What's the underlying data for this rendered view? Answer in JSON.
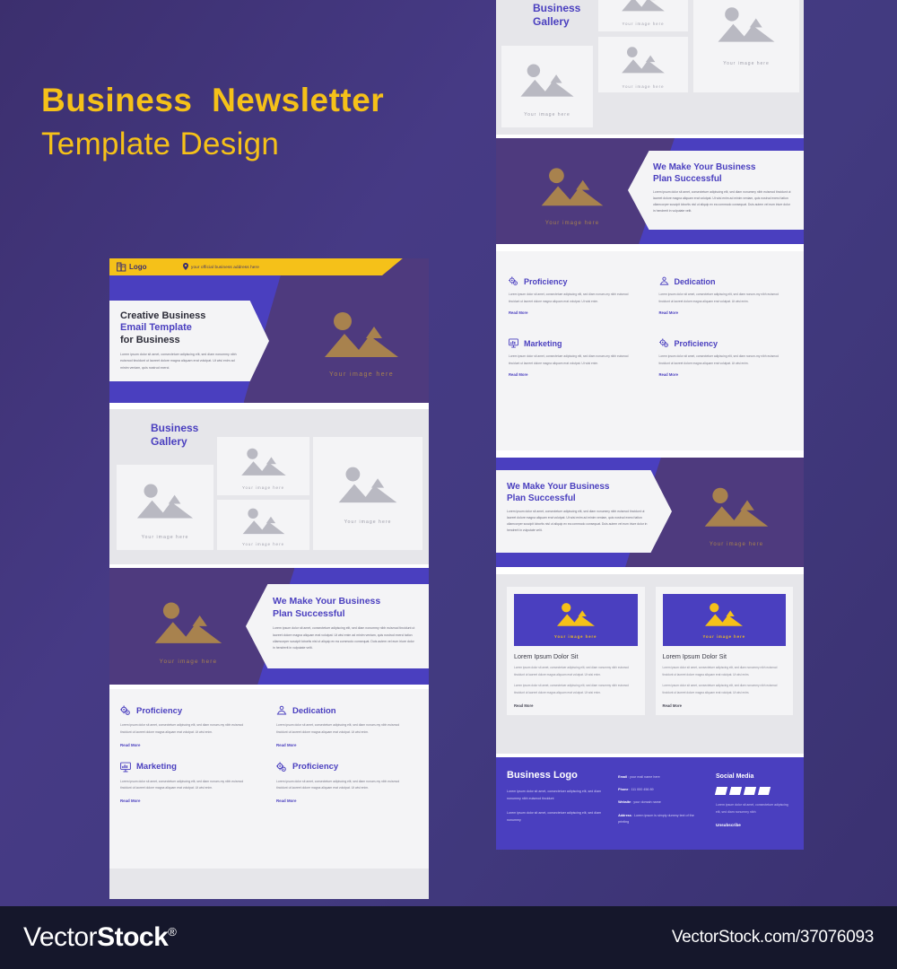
{
  "poster": {
    "title_line1": "Business  Newsletter",
    "title_line2": "Template Design",
    "accent_yellow": "#f5c119",
    "accent_purple": "#4a3fbf",
    "accent_dark_purple": "#4e3a7e",
    "background": "#43387e"
  },
  "topbar": {
    "logo_label": "Logo",
    "address": "your official business address here"
  },
  "hero": {
    "heading_line1": "Creative Business",
    "heading_line2": "Email Template",
    "heading_line3": "for Business",
    "body": "Lorem ipsum dolor sit amet, consectetuer adipiscing elit, sed diam nonummy nibh euismod tincidunt ut laoreet dolore magna aliquam erat volutpat. Ut wisi enim ad minim veniam, quis nostrud exerci.",
    "image_caption": "Your image here"
  },
  "gallery": {
    "title_line1": "Business",
    "title_line2": "Gallery",
    "items": [
      {
        "caption": "Your image here"
      },
      {
        "caption": "Your image here"
      },
      {
        "caption": "Your image here"
      },
      {
        "caption": "Your image here"
      }
    ]
  },
  "plan": {
    "heading_line1": "We Make Your Business",
    "heading_line2": "Plan Successful",
    "body": "Lorem ipsum dolor sit amet, consectetuer adipiscing elit, sed diam nonummy nibh euismod tincidunt ut laoreet dolore magna aliquam erat volutpat. Ut wisi enim ad minim veniam, quis nostrud exerci tation ullamcorper suscipit lobortis nisl ut aliquip ex ea commodo consequat. Duis autem vel eum iriure dolor in hendrerit in vulputate velit.",
    "image_caption": "Your image here"
  },
  "features": {
    "body": "Lorem ipsum dolor sit amet, consectetuer adipiscing elit, sed diam nonum-my nibh euismod tincidunt ut laoreet dolore magna aliquam erat volutpat. Ut wisi enim.",
    "read_more": "Read More",
    "items": [
      {
        "title": "Proficiency",
        "icon": "gears-icon"
      },
      {
        "title": "Dedication",
        "icon": "handshake-icon"
      },
      {
        "title": "Marketing",
        "icon": "chart-board-icon"
      },
      {
        "title": "Proficiency",
        "icon": "gears-icon"
      }
    ]
  },
  "cards": {
    "read_more": "Read More",
    "items": [
      {
        "image_caption": "Your image here",
        "title": "Lorem Ipsum Dolor Sit",
        "body1": "Lorem ipsum dolor sit amet, consectetuer adipiscing elit, sed diam nonummy nibh euismod tincidunt ut laoreet dolore magna aliquam erat volutpat. Ut wisi enim.",
        "body2": "Lorem ipsum dolor sit amet, consectetuer adipiscing elit, sed diam nonummy nibh euismod tincidunt ut laoreet dolore magna aliquam erat volutpat. Ut wisi enim."
      },
      {
        "image_caption": "Your image here",
        "title": "Lorem Ipsum Dolor Sit",
        "body1": "Lorem ipsum dolor sit amet, consectetuer adipiscing elit, sed diam nonummy nibh euismod tincidunt ut laoreet dolore magna aliquam erat volutpat. Ut wisi enim.",
        "body2": "Lorem ipsum dolor sit amet, consectetuer adipiscing elit, sed diam nonummy nibh euismod tincidunt ut laoreet dolore magna aliquam erat volutpat. Ut wisi enim."
      }
    ]
  },
  "footer": {
    "brand": "Business Logo",
    "about1": "Lorem ipsum dolor sit amet, consectetuer adipiscing elit, sed diam nonummy nibh euismod tincidunt",
    "about2": "Lorem ipsum dolor sit amet, consectetuer adipiscing elit, sed diam nonummy",
    "contact": [
      {
        "label": "Email",
        "value": "your mail name here"
      },
      {
        "label": "Phone",
        "value": "111 000 456 89"
      },
      {
        "label": "Website",
        "value": "your domain name"
      },
      {
        "label": "Address",
        "value": "Lorem ipsum is simply dummy text of the printing"
      }
    ],
    "social_title": "Social Media",
    "social_note": "Lorem ipsum dolor sit amet, consectetuer adipiscing elit, sed diam nonummy nibh",
    "unsubscribe": "Unsubscribe"
  },
  "watermark": {
    "logo_thin": "Vector",
    "logo_bold": "Stock",
    "registered": "®",
    "url": "VectorStock.com/37076093"
  }
}
